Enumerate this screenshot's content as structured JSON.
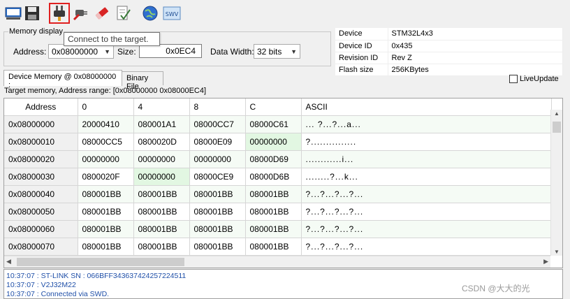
{
  "toolbar": {
    "buttons": [
      {
        "icon": "monitor-icon"
      },
      {
        "icon": "save-icon"
      },
      {
        "icon": "connect-plug-icon",
        "active": true
      },
      {
        "icon": "disconnect-plug-icon"
      },
      {
        "icon": "erase-icon"
      },
      {
        "icon": "program-verify-icon"
      },
      {
        "icon": "globe-network-icon"
      },
      {
        "icon": "swv-icon",
        "text": "SWV"
      }
    ],
    "tooltip": "Connect to the target."
  },
  "memory_display": {
    "label": "Memory display",
    "address_label": "Address:",
    "address_value": "0x08000000",
    "size_label": "Size:",
    "size_value": "0x0EC4",
    "data_width_label": "Data Width:",
    "data_width_value": "32 bits"
  },
  "device_info": [
    {
      "key": "Device",
      "value": "STM32L4x3"
    },
    {
      "key": "Device ID",
      "value": "0x435"
    },
    {
      "key": "Revision ID",
      "value": "Rev Z"
    },
    {
      "key": "Flash size",
      "value": "256KBytes"
    }
  ],
  "tabs": [
    {
      "label": "Device Memory @ 0x08000000 :"
    },
    {
      "label": "Binary File"
    }
  ],
  "live_update_label": "LiveUpdate",
  "range_label": "Target memory, Address range: [0x08000000 0x08000EC4]",
  "grid": {
    "headers": [
      "Address",
      "0",
      "4",
      "8",
      "C",
      "ASCII"
    ],
    "rows": [
      {
        "addr": "0x08000000",
        "cells": [
          "20000410",
          "080001A1",
          "08000CC7",
          "08000C61"
        ],
        "ascii": "...  ?...?...a..."
      },
      {
        "addr": "0x08000010",
        "cells": [
          "08000CC5",
          "0800020D",
          "08000E09",
          "00000000"
        ],
        "ascii": "?..............."
      },
      {
        "addr": "0x08000020",
        "cells": [
          "00000000",
          "00000000",
          "00000000",
          "08000D69"
        ],
        "ascii": "............i..."
      },
      {
        "addr": "0x08000030",
        "cells": [
          "0800020F",
          "00000000",
          "08000CE9",
          "08000D6B"
        ],
        "ascii": "........?...k..."
      },
      {
        "addr": "0x08000040",
        "cells": [
          "080001BB",
          "080001BB",
          "080001BB",
          "080001BB"
        ],
        "ascii": "?...?...?...?..."
      },
      {
        "addr": "0x08000050",
        "cells": [
          "080001BB",
          "080001BB",
          "080001BB",
          "080001BB"
        ],
        "ascii": "?...?...?...?..."
      },
      {
        "addr": "0x08000060",
        "cells": [
          "080001BB",
          "080001BB",
          "080001BB",
          "080001BB"
        ],
        "ascii": "?...?...?...?..."
      },
      {
        "addr": "0x08000070",
        "cells": [
          "080001BB",
          "080001BB",
          "080001BB",
          "080001BB"
        ],
        "ascii": "?...?...?...?..."
      }
    ]
  },
  "log": [
    "10:37:07 : ST-LINK SN : 066BFF343637424257224511",
    "10:37:07 : V2J32M22",
    "10:37:07 : Connected via SWD."
  ],
  "watermark": "CSDN @大大的光",
  "colors": {
    "active_border": "#e02020",
    "zero_cell": "#e2f7e2",
    "log_text": "#1f4fa8"
  }
}
